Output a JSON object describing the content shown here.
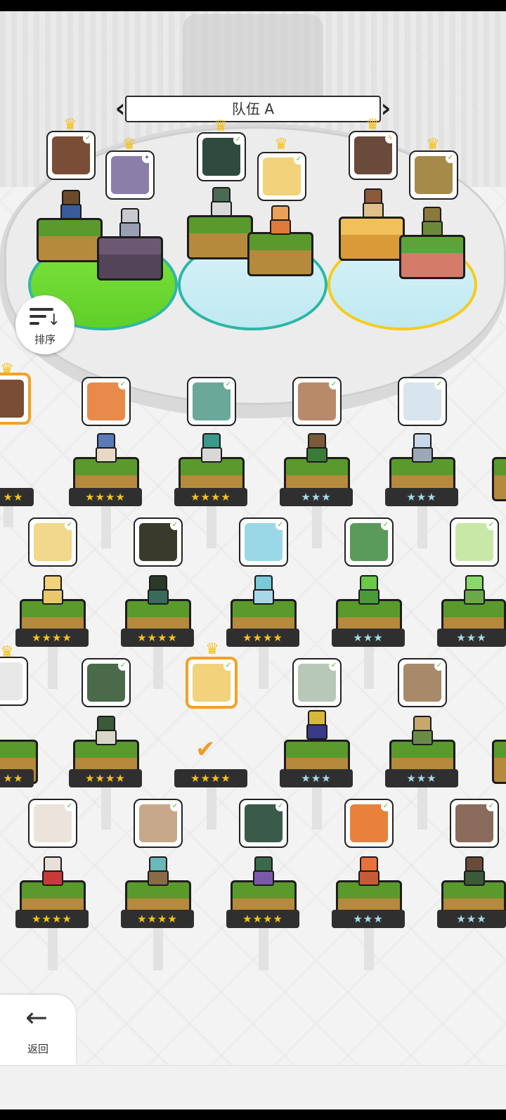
{
  "team": {
    "prev_icon": "chevron-left-icon",
    "title": "队伍 A",
    "next_icon": "chevron-right-icon"
  },
  "sort": {
    "icon": "sort-icon",
    "label": "排序"
  },
  "back": {
    "icon": "arrow-left-icon",
    "label": "返回"
  },
  "colors": {
    "accent_gold": "#f4c21d",
    "select_orange": "#f39a2b",
    "pad_green": "#7ee23b",
    "pad_blue": "#bfe9f2"
  },
  "roster_stars": {
    "four": "★★★★",
    "three": "★★★",
    "two": "★★"
  }
}
